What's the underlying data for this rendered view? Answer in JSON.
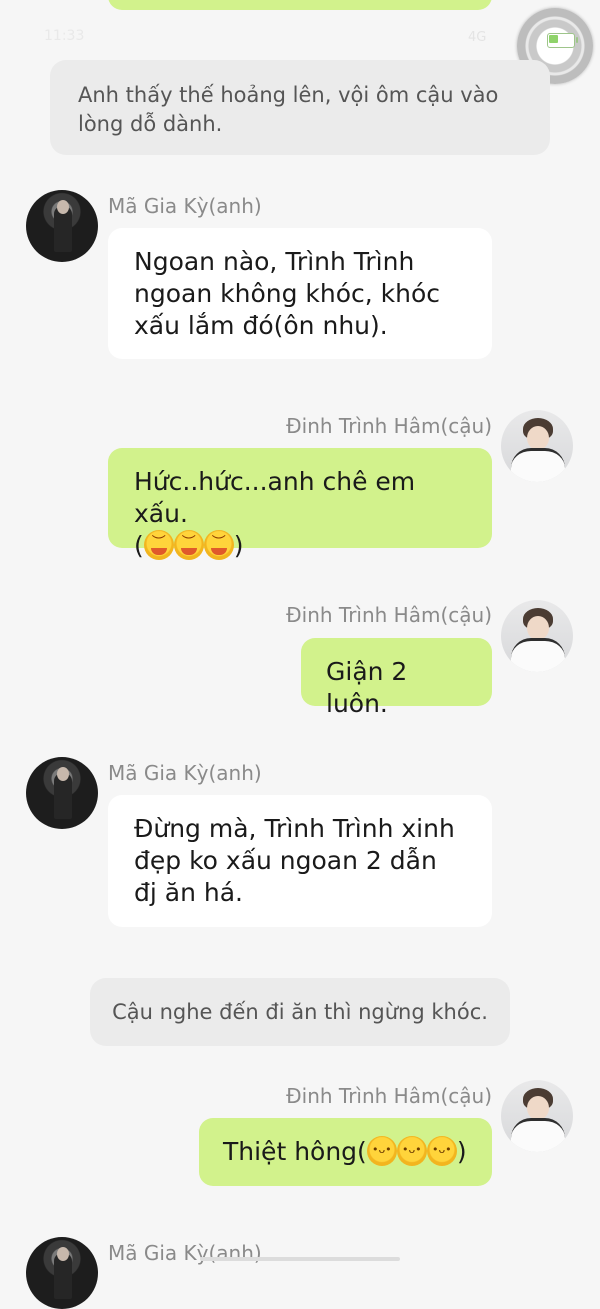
{
  "status": {
    "time": "11:33",
    "signal": "4G"
  },
  "chat": {
    "narration_1": "Anh thấy thế hoảng lên, vội ôm cậu vào lòng dỗ dành.",
    "narration_2": "Cậu nghe đến đi ăn thì ngừng khóc.",
    "participants": {
      "anh": "Mã Gia Kỳ(anh)",
      "cau": "Đinh Trình Hâm(cậu)"
    },
    "messages": [
      {
        "sender": "Mã Gia Kỳ(anh)",
        "text": "Ngoan nào, Trình Trình ngoan không khóc, khóc xấu lắm đó(ôn nhu)."
      },
      {
        "sender": "Đinh Trình Hâm(cậu)",
        "text": "Hức..hức...anh chê em xấu.",
        "text2_open": "(",
        "text2_close": ")"
      },
      {
        "sender": "Đinh Trình Hâm(cậu)",
        "text": "Giận 2 luôn."
      },
      {
        "sender": "Mã Gia Kỳ(anh)",
        "text": "Đừng mà, Trình Trình xinh đẹp ko xấu ngoan 2 dẫn đj ăn há."
      },
      {
        "sender": "Đinh Trình Hâm(cậu)",
        "text": "Thiệt hông(",
        "text_close": ")"
      },
      {
        "sender": "Mã Gia Kỳ(anh)"
      }
    ]
  },
  "icons": {
    "crying_emoji": "crying-face-icon",
    "pouting_emoji": "pouting-face-icon",
    "battery": "battery-icon",
    "floating_button": "assistive-touch-icon"
  },
  "colors": {
    "background": "#f6f6f6",
    "green_bubble": "#d2f28c",
    "white_bubble": "#ffffff",
    "narration": "#ebebeb"
  }
}
